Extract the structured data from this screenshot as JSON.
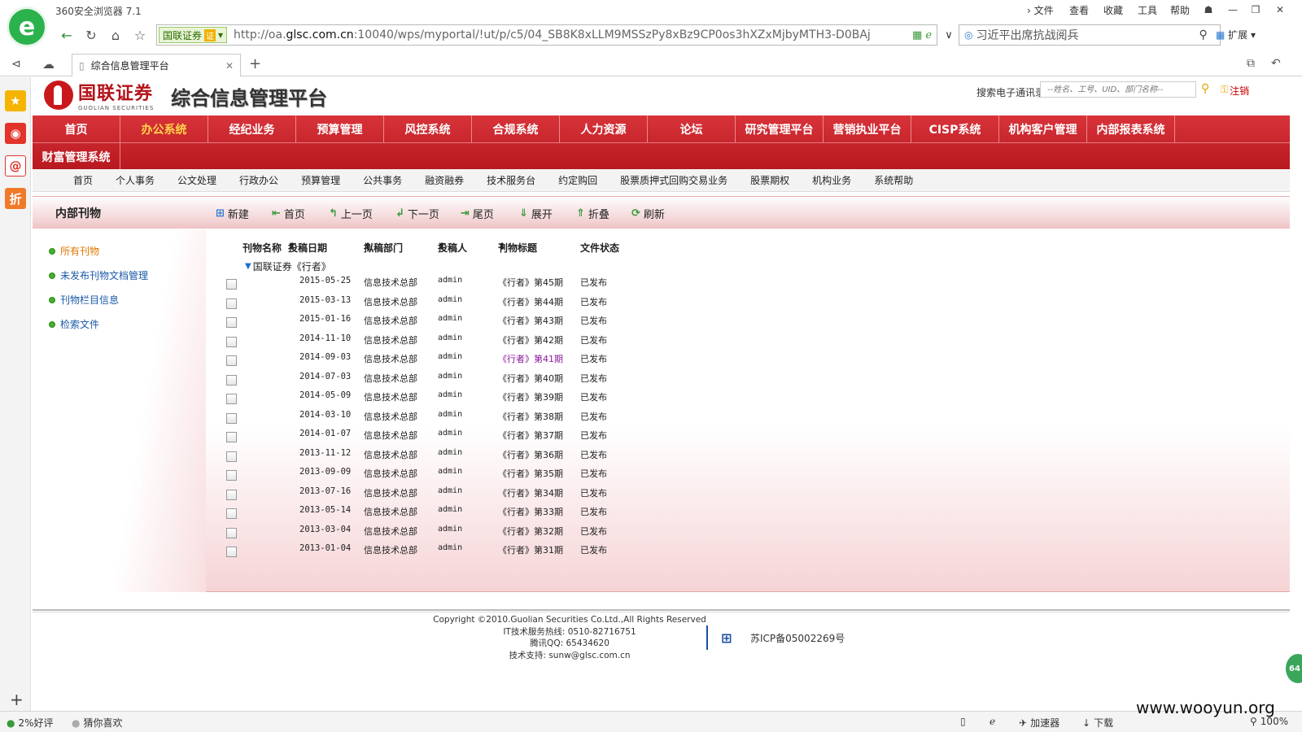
{
  "browser": {
    "app_title": "360安全浏览器 7.1",
    "menu": [
      "文件",
      "查看",
      "收藏",
      "工具",
      "帮助"
    ],
    "site_badge": "国联证券",
    "site_cert": "证",
    "url_prefix": "http://oa.",
    "url_host": "glsc.com.cn",
    "url_rest": ":10040/wps/myportal/!ut/p/c5/04_SB8K8xLLM9MSSzPy8xBz9CP0os3hXZxMjbyMTH3-D0BAj",
    "search_value": "习近平出席抗战阅兵",
    "extend_label": "扩展",
    "tab_title": "综合信息管理平台"
  },
  "header": {
    "logo_cn": "国联证券",
    "logo_en": "GUOLIAN SECURITIES",
    "platform_title": "综合信息管理平台",
    "directory_label": "搜索电子通讯录:",
    "directory_placeholder": "--姓名、工号、UID、部门名称--",
    "logout_label": "注销"
  },
  "main_nav": {
    "row1": [
      "首页",
      "办公系统",
      "经纪业务",
      "预算管理",
      "风控系统",
      "合规系统",
      "人力资源",
      "论坛",
      "研究管理平台",
      "营销执业平台",
      "CISP系统",
      "机构客户管理",
      "内部报表系统"
    ],
    "row2": [
      "财富管理系统"
    ],
    "active": "办公系统"
  },
  "sub_nav": [
    "首页",
    "个人事务",
    "公文处理",
    "行政办公",
    "预算管理",
    "公共事务",
    "融资融券",
    "技术服务台",
    "约定购回",
    "股票质押式回购交易业务",
    "股票期权",
    "机构业务",
    "系统帮助"
  ],
  "toolbar": {
    "section_title": "内部刊物",
    "buttons": {
      "new": "新建",
      "first": "首页",
      "prev": "上一页",
      "next": "下一页",
      "last": "尾页",
      "expand": "展开",
      "collapse": "折叠",
      "refresh": "刷新"
    }
  },
  "left_panel": {
    "items": [
      "所有刊物",
      "未发布刊物文档管理",
      "刊物栏目信息",
      "检索文件"
    ]
  },
  "table": {
    "headers": {
      "name": "刊物名称",
      "date": "投稿日期",
      "dept": "拟稿部门",
      "author": "投稿人",
      "title": "刊物标题",
      "status": "文件状态"
    },
    "group": "国联证券《行者》",
    "rows": [
      {
        "date": "2015-05-25",
        "dept": "信息技术总部",
        "author": "admin",
        "title": "《行者》第45期",
        "status": "已发布"
      },
      {
        "date": "2015-03-13",
        "dept": "信息技术总部",
        "author": "admin",
        "title": "《行者》第44期",
        "status": "已发布"
      },
      {
        "date": "2015-01-16",
        "dept": "信息技术总部",
        "author": "admin",
        "title": "《行者》第43期",
        "status": "已发布"
      },
      {
        "date": "2014-11-10",
        "dept": "信息技术总部",
        "author": "admin",
        "title": "《行者》第42期",
        "status": "已发布"
      },
      {
        "date": "2014-09-03",
        "dept": "信息技术总部",
        "author": "admin",
        "title": "《行者》第41期",
        "status": "已发布"
      },
      {
        "date": "2014-07-03",
        "dept": "信息技术总部",
        "author": "admin",
        "title": "《行者》第40期",
        "status": "已发布"
      },
      {
        "date": "2014-05-09",
        "dept": "信息技术总部",
        "author": "admin",
        "title": "《行者》第39期",
        "status": "已发布"
      },
      {
        "date": "2014-03-10",
        "dept": "信息技术总部",
        "author": "admin",
        "title": "《行者》第38期",
        "status": "已发布"
      },
      {
        "date": "2014-01-07",
        "dept": "信息技术总部",
        "author": "admin",
        "title": "《行者》第37期",
        "status": "已发布"
      },
      {
        "date": "2013-11-12",
        "dept": "信息技术总部",
        "author": "admin",
        "title": "《行者》第36期",
        "status": "已发布"
      },
      {
        "date": "2013-09-09",
        "dept": "信息技术总部",
        "author": "admin",
        "title": "《行者》第35期",
        "status": "已发布"
      },
      {
        "date": "2013-07-16",
        "dept": "信息技术总部",
        "author": "admin",
        "title": "《行者》第34期",
        "status": "已发布"
      },
      {
        "date": "2013-05-14",
        "dept": "信息技术总部",
        "author": "admin",
        "title": "《行者》第33期",
        "status": "已发布"
      },
      {
        "date": "2013-03-04",
        "dept": "信息技术总部",
        "author": "admin",
        "title": "《行者》第32期",
        "status": "已发布"
      },
      {
        "date": "2013-01-04",
        "dept": "信息技术总部",
        "author": "admin",
        "title": "《行者》第31期",
        "status": "已发布"
      }
    ]
  },
  "footer": {
    "copyright": "Copyright ©2010.Guolian Securities Co.Ltd.,All Rights Reserved",
    "hotline": "IT技术服务热线: 0510-82716751",
    "qq": "腾讯QQ: 65434620",
    "support": "技术支持: sunw@glsc.com.cn",
    "icp": "苏ICP备05002269号"
  },
  "statusbar": {
    "rating": "2%好评",
    "guess": "猜你喜欢",
    "accelerator": "加速器",
    "download": "下载",
    "zoom": "100%"
  },
  "float_badge": "64",
  "watermark": "www.wooyun.org",
  "colors": {
    "nav_red": "#c8242b",
    "active_nav": "#ffd54a",
    "link_blue": "#1a5aa8",
    "visited": "#8a1a9a"
  }
}
